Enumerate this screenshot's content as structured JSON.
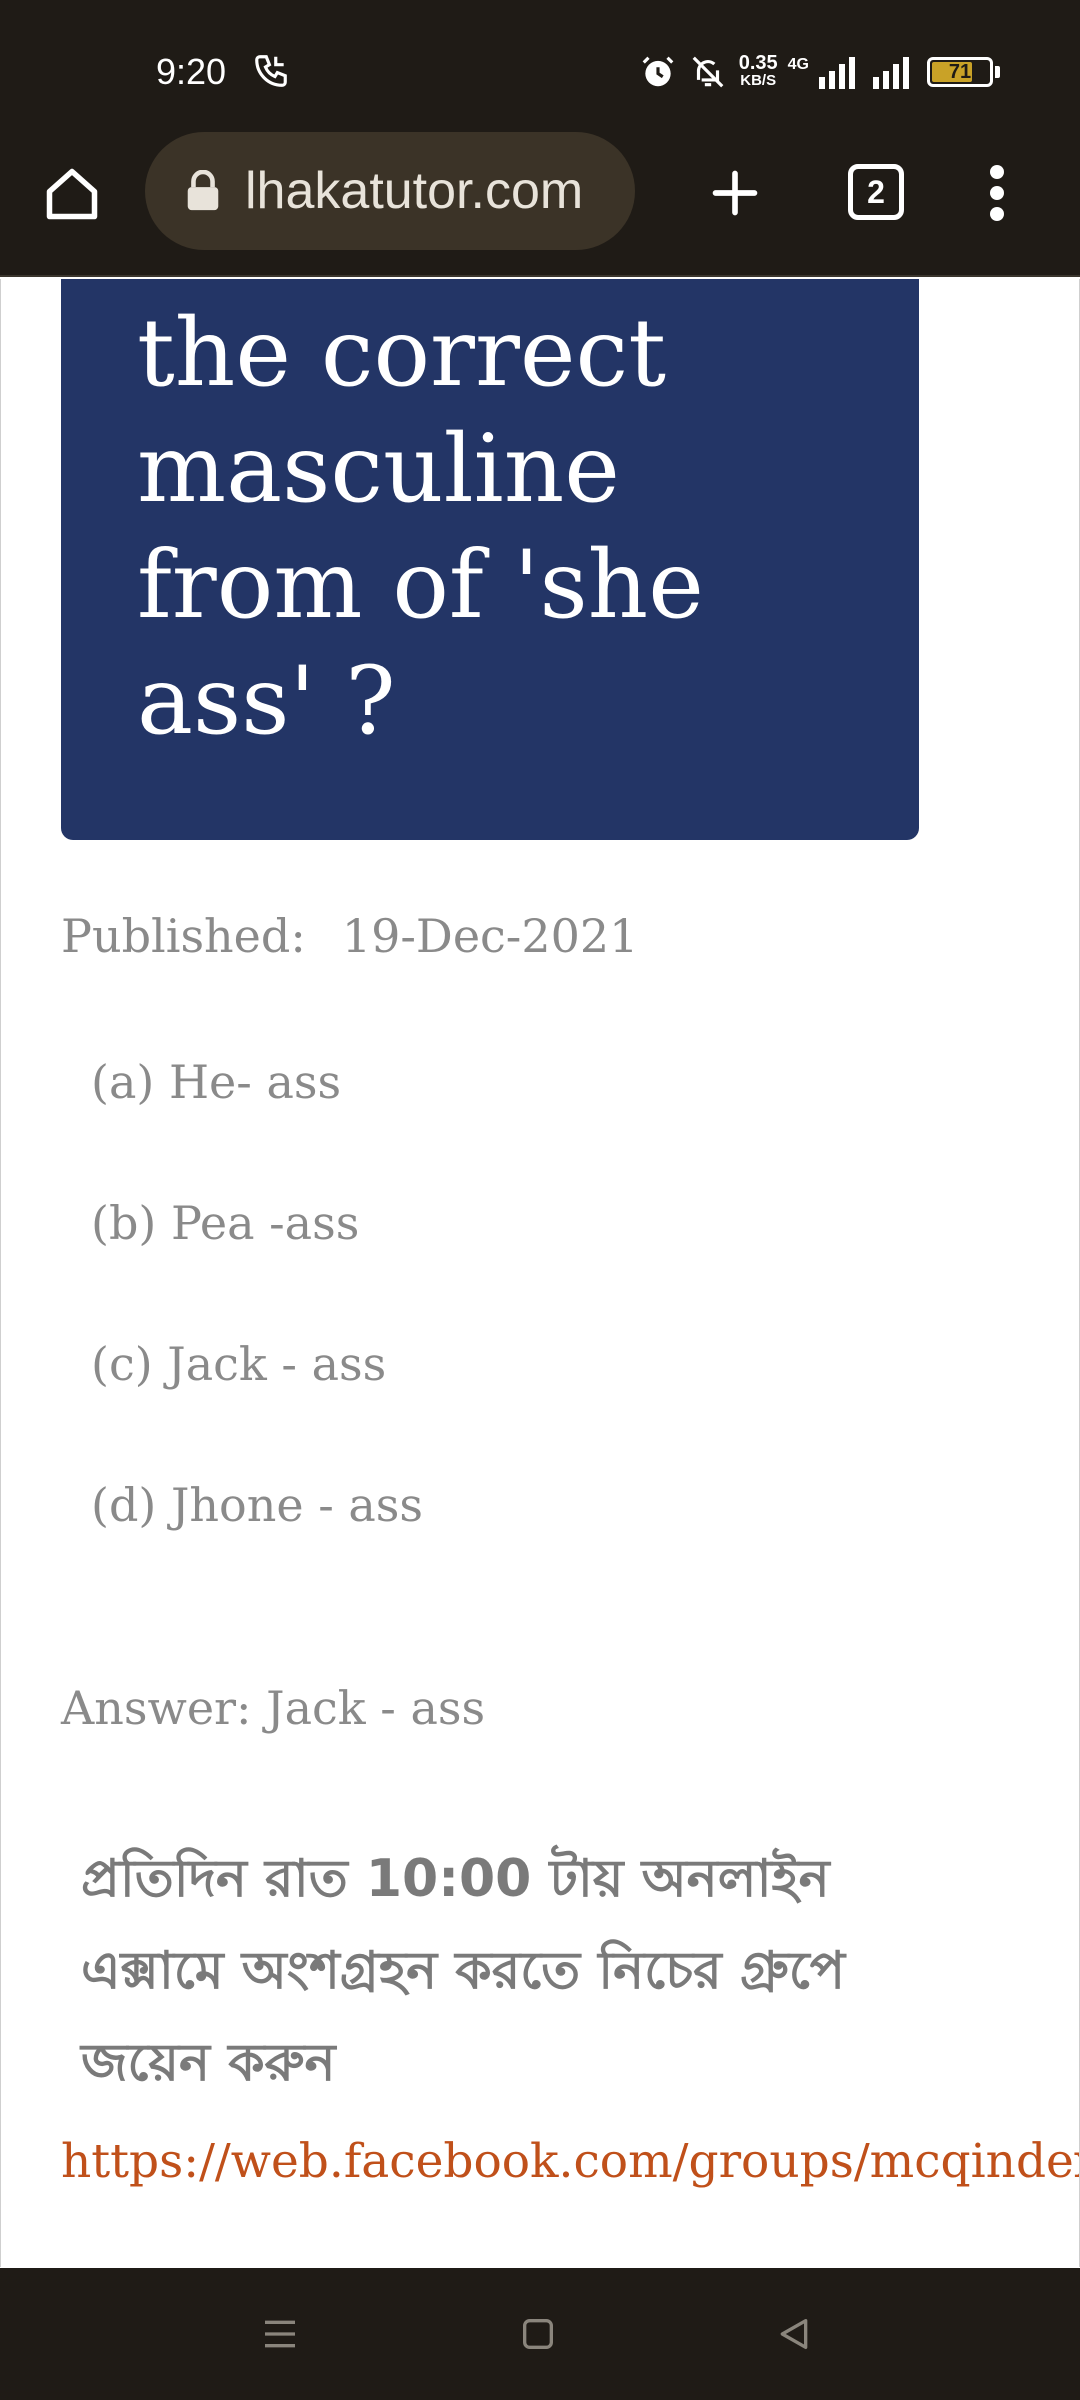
{
  "status_bar": {
    "time": "9:20",
    "net_speed_value": "0.35",
    "net_speed_unit": "KB/S",
    "network_type": "4G",
    "battery_level": "71",
    "icons": [
      "call-icon",
      "alarm-icon",
      "mute-icon",
      "signal-icon",
      "signal-icon",
      "battery-icon"
    ]
  },
  "browser": {
    "url": "lhakatutor.com",
    "tab_count": "2"
  },
  "article": {
    "question": "Which one is the correct masculine from of 'she ass' ?",
    "published_label": "Published:",
    "published_date": "19-Dec-2021",
    "options": [
      "(a) He- ass",
      "(b) Pea -ass",
      "(c) Jack - ass",
      "(d) Jhone - ass"
    ],
    "answer": "Answer: Jack - ass",
    "note_bengali": "প্রতিদিন রাত 10:00 টায় অনলাইন এক্সামে অংশগ্রহন করতে নিচের গ্রুপে জয়েন করুন",
    "link": "https://web.facebook.com/groups/mcqindex"
  },
  "colors": {
    "chrome_bg": "#1f1b16",
    "url_bar_bg": "#3b3327",
    "card_bg": "#233566",
    "link": "#c0501a",
    "muted_text": "#8a8a8a"
  }
}
